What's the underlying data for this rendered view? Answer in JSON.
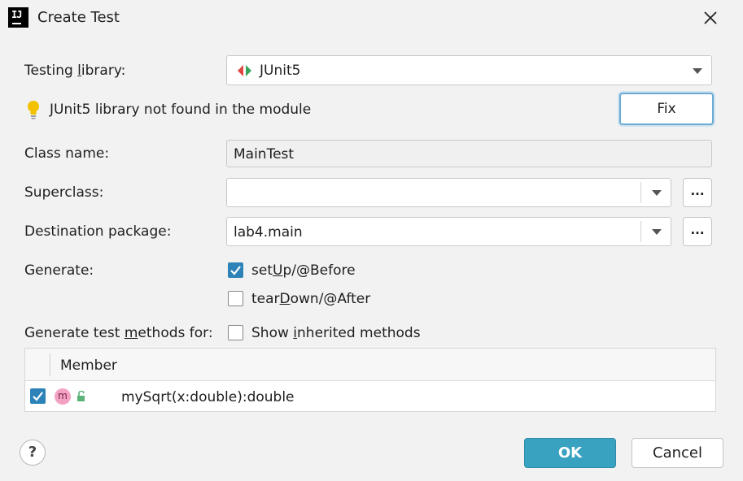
{
  "window": {
    "title": "Create Test",
    "app_icon_text": "IJ"
  },
  "testing_library": {
    "label_pre": "Testing ",
    "label_u": "l",
    "label_post": "ibrary:",
    "value": "JUnit5"
  },
  "warning": {
    "text": "JUnit5 library not found in the module",
    "fix_button": "Fix"
  },
  "class_name": {
    "label": "Class name:",
    "value": "MainTest"
  },
  "superclass": {
    "label": "Superclass:",
    "value": "",
    "browse": "..."
  },
  "destination": {
    "label": "Destination package:",
    "value": "lab4.main",
    "browse": "..."
  },
  "generate": {
    "label": "Generate:",
    "options": [
      {
        "pre": "set",
        "u": "U",
        "post": "p/@Before",
        "checked": true
      },
      {
        "pre": "tear",
        "u": "D",
        "post": "own/@After",
        "checked": false
      }
    ]
  },
  "methods_for": {
    "label_pre": "Generate test ",
    "label_u": "m",
    "label_post": "ethods for:",
    "show_inherited_pre": "Show ",
    "show_inherited_u": "i",
    "show_inherited_post": "nherited methods",
    "show_inherited_checked": false
  },
  "members_table": {
    "header": "Member",
    "rows": [
      {
        "checked": true,
        "badge": "m",
        "name": "mySqrt(x:double):double"
      }
    ]
  },
  "footer": {
    "help": "?",
    "ok": "OK",
    "cancel": "Cancel"
  },
  "colors": {
    "accent": "#39a2c1",
    "checkbox": "#2d83b8",
    "badge": "#f3a2c4"
  }
}
